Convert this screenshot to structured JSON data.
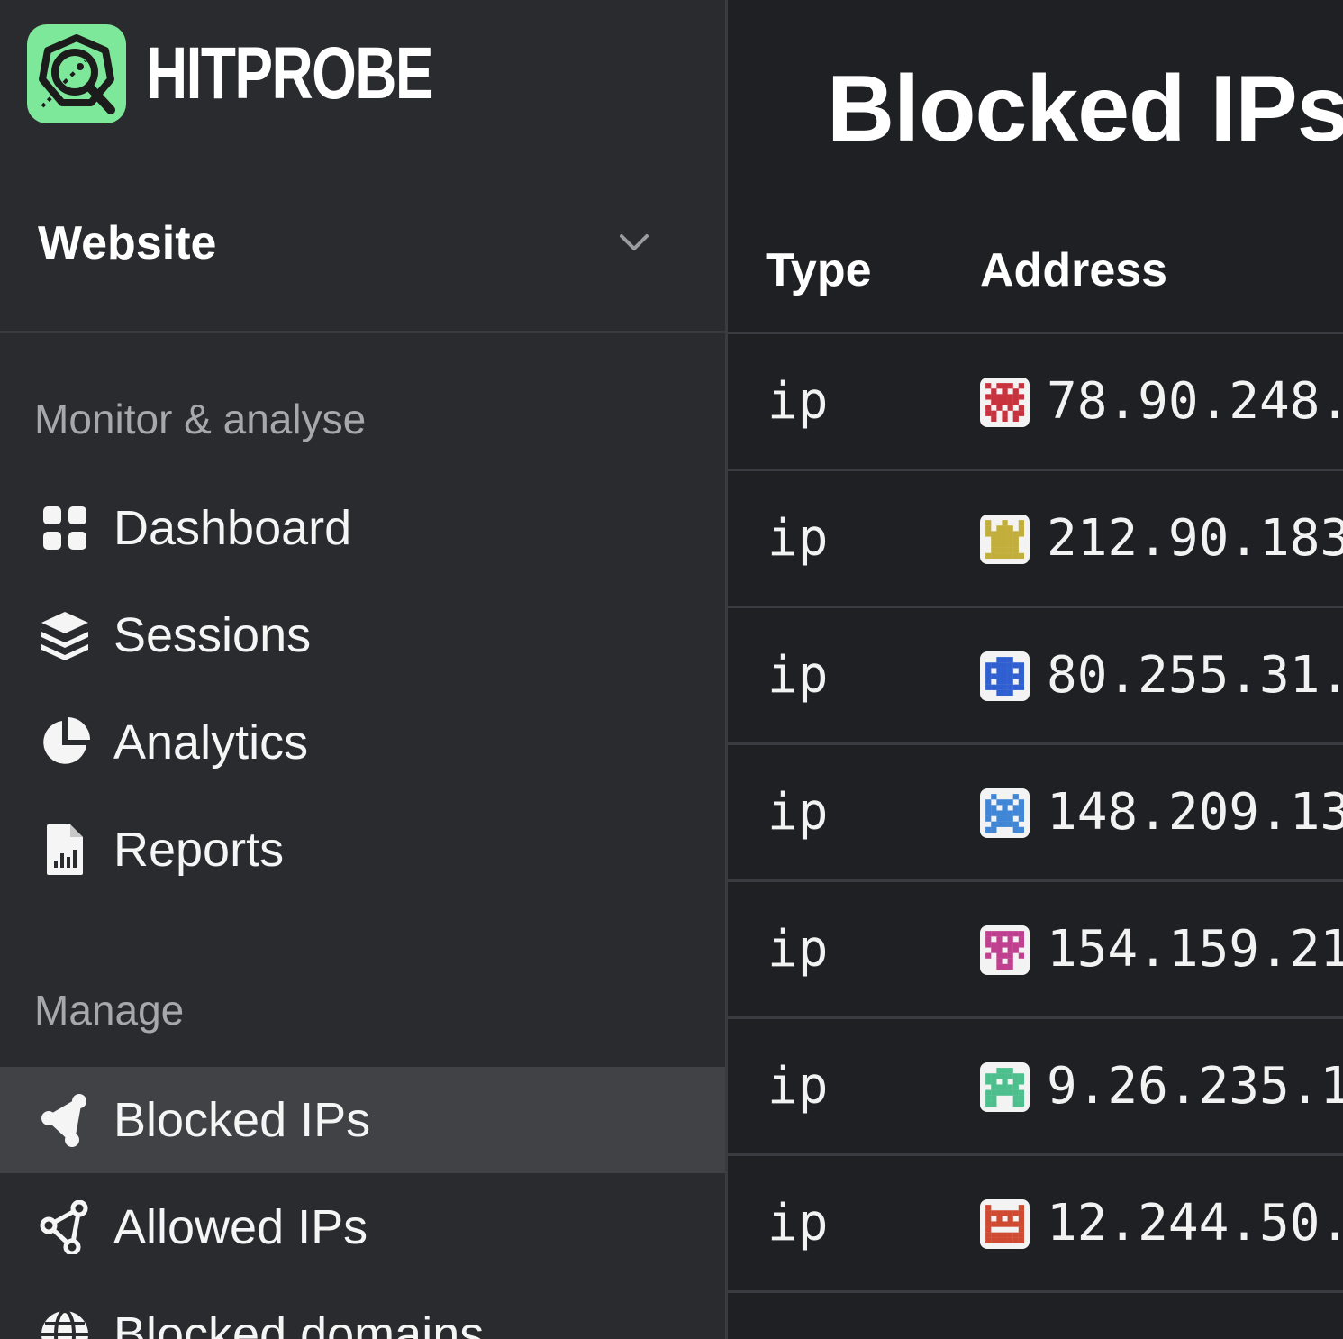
{
  "app": {
    "name": "HITPROBE",
    "accent": "#7ee89a"
  },
  "site_selector": {
    "value": "Website"
  },
  "sidebar": {
    "sections": [
      {
        "label": "Monitor & analyse",
        "items": [
          {
            "label": "Dashboard",
            "icon": "grid-icon"
          },
          {
            "label": "Sessions",
            "icon": "layers-icon"
          },
          {
            "label": "Analytics",
            "icon": "pie-chart-icon"
          },
          {
            "label": "Reports",
            "icon": "report-file-icon"
          }
        ]
      },
      {
        "label": "Manage",
        "items": [
          {
            "label": "Blocked IPs",
            "icon": "share-nodes-icon",
            "active": true
          },
          {
            "label": "Allowed IPs",
            "icon": "share-nodes-outline-icon"
          },
          {
            "label": "Blocked domains",
            "icon": "globe-icon"
          }
        ]
      }
    ]
  },
  "main": {
    "title": "Blocked IPs",
    "columns": [
      "Type",
      "Address"
    ],
    "rows": [
      {
        "type": "ip",
        "address": "78.90.248.",
        "avatar_color": "#c8323c"
      },
      {
        "type": "ip",
        "address": "212.90.183",
        "avatar_color": "#c2ae3a"
      },
      {
        "type": "ip",
        "address": "80.255.31.",
        "avatar_color": "#2f5fd0"
      },
      {
        "type": "ip",
        "address": "148.209.13",
        "avatar_color": "#3f86d6"
      },
      {
        "type": "ip",
        "address": "154.159.21",
        "avatar_color": "#c0408f"
      },
      {
        "type": "ip",
        "address": "9.26.235.1",
        "avatar_color": "#4cbf8d"
      },
      {
        "type": "ip",
        "address": "12.244.50.",
        "avatar_color": "#d04a32"
      }
    ]
  }
}
